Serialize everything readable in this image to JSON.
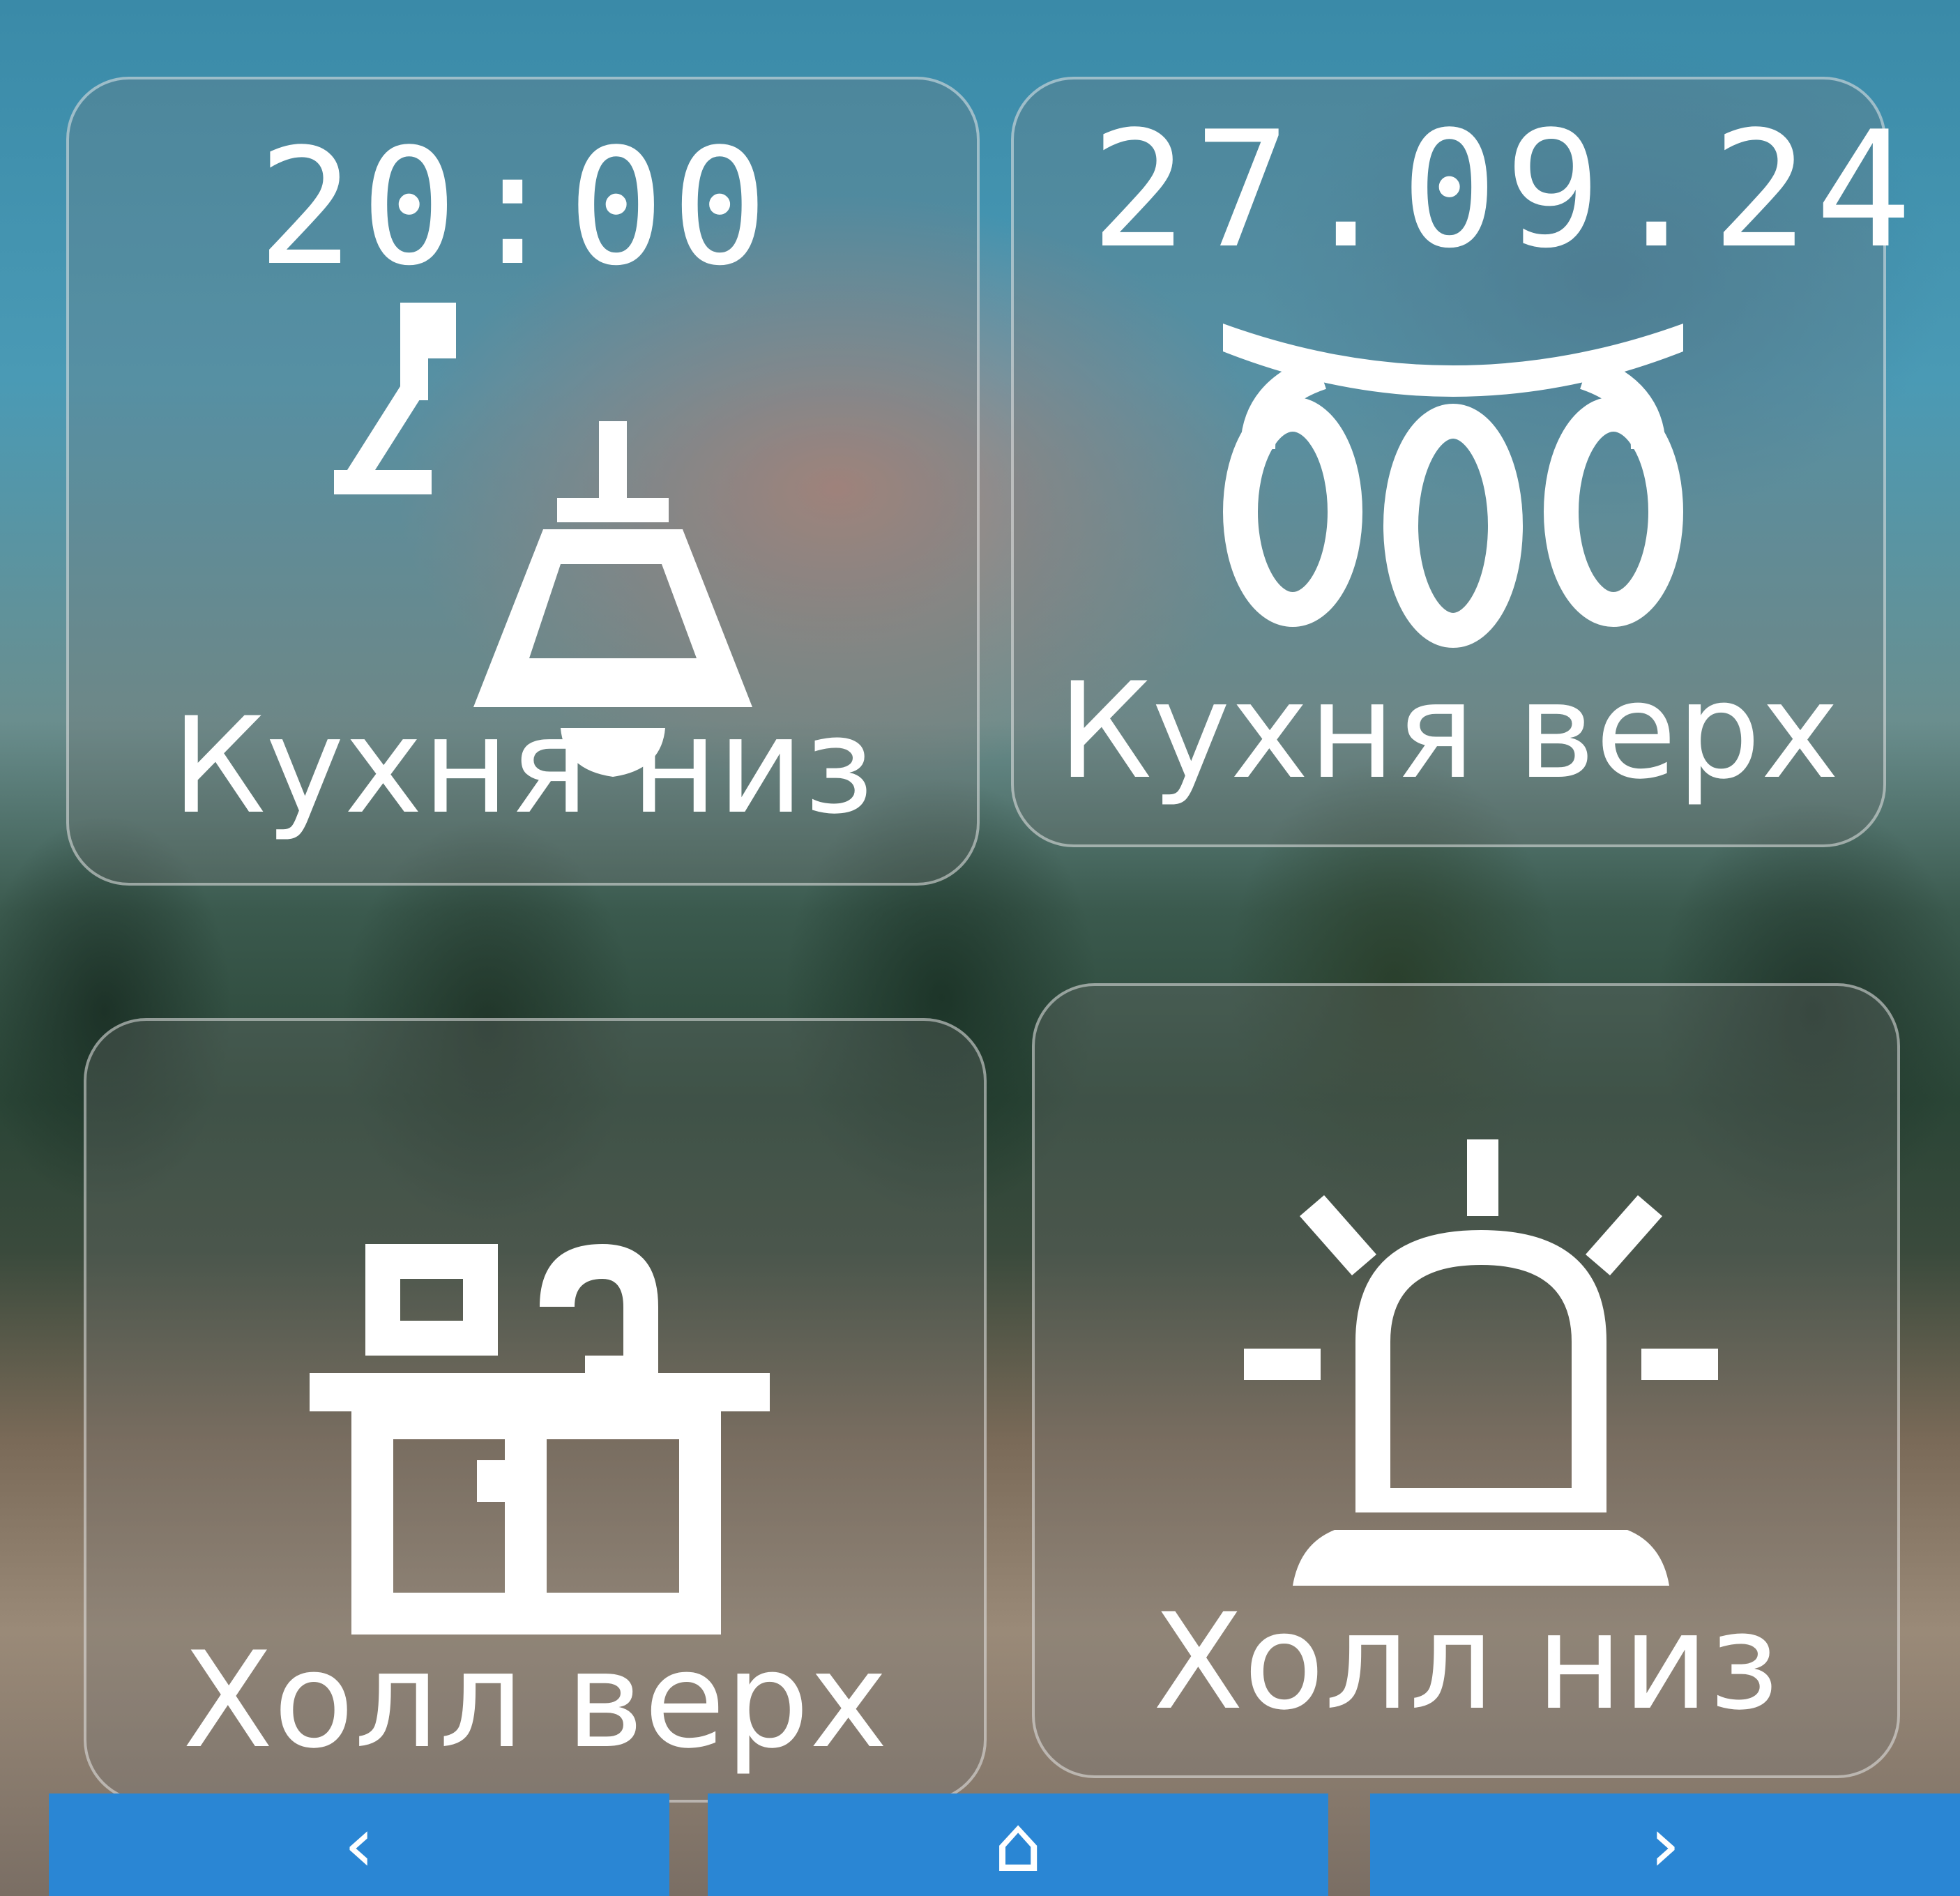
{
  "status": {
    "time": "20:00",
    "date": "27.09.24"
  },
  "tiles": [
    {
      "label": "Кухня низ",
      "icon": "pendant-lamp-icon"
    },
    {
      "label": "Кухня верх",
      "icon": "chandelier-icon"
    },
    {
      "label": "Холл верх",
      "icon": "wall-lamp-icon"
    },
    {
      "label": "Холл низ",
      "icon": "beacon-lamp-icon"
    }
  ],
  "nav": {
    "prev": "‹",
    "home": "⌂",
    "next": "›"
  },
  "colors": {
    "nav_bar": "#2a86d4",
    "icon": "#ffffff",
    "tile_border": "rgba(255,255,255,0.45)"
  }
}
